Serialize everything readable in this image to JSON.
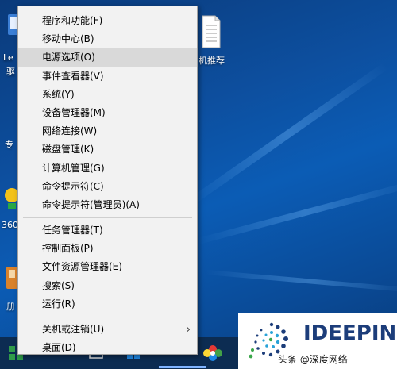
{
  "desktop": {
    "icons": [
      {
        "name": "lenovo-icon",
        "label": "Le"
      },
      {
        "name": "lenovo-icon-line2",
        "label": "驱"
      },
      {
        "name": "specialist-icon",
        "label": "专"
      },
      {
        "name": "360-icon",
        "label": "360"
      },
      {
        "name": "desktop-folder-icon",
        "label": "册"
      },
      {
        "name": "recommend-file-icon",
        "label": "机推荐"
      }
    ]
  },
  "context_menu": {
    "group1": [
      {
        "label": "程序和功能(F)"
      },
      {
        "label": "移动中心(B)"
      },
      {
        "label": "电源选项(O)",
        "highlighted": true
      },
      {
        "label": "事件查看器(V)"
      },
      {
        "label": "系统(Y)"
      },
      {
        "label": "设备管理器(M)"
      },
      {
        "label": "网络连接(W)"
      },
      {
        "label": "磁盘管理(K)"
      },
      {
        "label": "计算机管理(G)"
      },
      {
        "label": "命令提示符(C)"
      },
      {
        "label": "命令提示符(管理员)(A)"
      }
    ],
    "group2": [
      {
        "label": "任务管理器(T)"
      },
      {
        "label": "控制面板(P)"
      },
      {
        "label": "文件资源管理器(E)"
      },
      {
        "label": "搜索(S)"
      },
      {
        "label": "运行(R)"
      }
    ],
    "group3": [
      {
        "label": "关机或注销(U)",
        "has_submenu": true
      },
      {
        "label": "桌面(D)"
      }
    ]
  },
  "watermark": {
    "brand": "IDEEPIN",
    "credit": "头条 @深度网络"
  },
  "colors": {
    "menu_bg": "#f2f2f2",
    "highlight": "#d9d9d9",
    "brand_blue": "#1c3d7a",
    "desktop_blue": "#0d4f9f"
  }
}
